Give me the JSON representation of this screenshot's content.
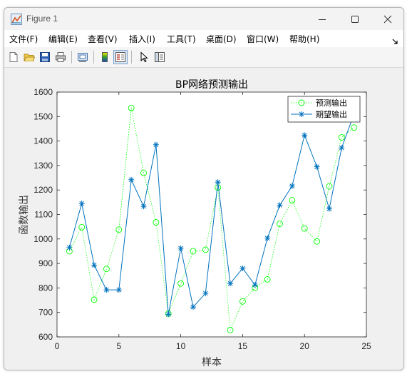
{
  "window": {
    "title": "Figure 1"
  },
  "menu": {
    "items": [
      {
        "label": "文件(F)"
      },
      {
        "label": "编辑(E)"
      },
      {
        "label": "查看(V)"
      },
      {
        "label": "插入(I)"
      },
      {
        "label": "工具(T)"
      },
      {
        "label": "桌面(D)"
      },
      {
        "label": "窗口(W)"
      },
      {
        "label": "帮助(H)"
      }
    ]
  },
  "toolbar": {
    "buttons": [
      "new-figure-icon",
      "open-file-icon",
      "save-icon",
      "print-icon",
      "link-plot-icon",
      "colorbar-icon",
      "legend-icon",
      "pointer-icon",
      "property-editor-icon"
    ]
  },
  "chart_data": {
    "type": "line",
    "title": "BP网络预测输出",
    "xlabel": "样本",
    "ylabel": "函数输出",
    "xlim": [
      0,
      25
    ],
    "ylim": [
      600,
      1600
    ],
    "xticks": [
      "0",
      "5",
      "10",
      "15",
      "20",
      "25"
    ],
    "yticks": [
      "600",
      "700",
      "800",
      "900",
      "1000",
      "1100",
      "1200",
      "1300",
      "1400",
      "1500",
      "1600"
    ],
    "grid": false,
    "legend_position": "top-right",
    "x": [
      1,
      2,
      3,
      4,
      5,
      6,
      7,
      8,
      9,
      10,
      11,
      12,
      13,
      14,
      15,
      16,
      17,
      18,
      19,
      20,
      21,
      22,
      23,
      24
    ],
    "series": [
      {
        "name": "预测输出",
        "color": "#00ff00",
        "style": "dotted",
        "marker": "circle",
        "values": [
          950,
          1048,
          752,
          878,
          1038,
          1535,
          1270,
          1068,
          695,
          818,
          950,
          956,
          1210,
          628,
          745,
          800,
          835,
          1062,
          1158,
          1043,
          990,
          1215,
          1415,
          1455
        ]
      },
      {
        "name": "期望输出",
        "color": "#0072bd",
        "style": "solid",
        "marker": "asterisk",
        "values": [
          965,
          1145,
          893,
          792,
          792,
          1242,
          1133,
          1385,
          692,
          962,
          722,
          778,
          1232,
          818,
          880,
          812,
          1003,
          1138,
          1216,
          1424,
          1295,
          1123,
          1372,
          1510
        ]
      }
    ]
  }
}
